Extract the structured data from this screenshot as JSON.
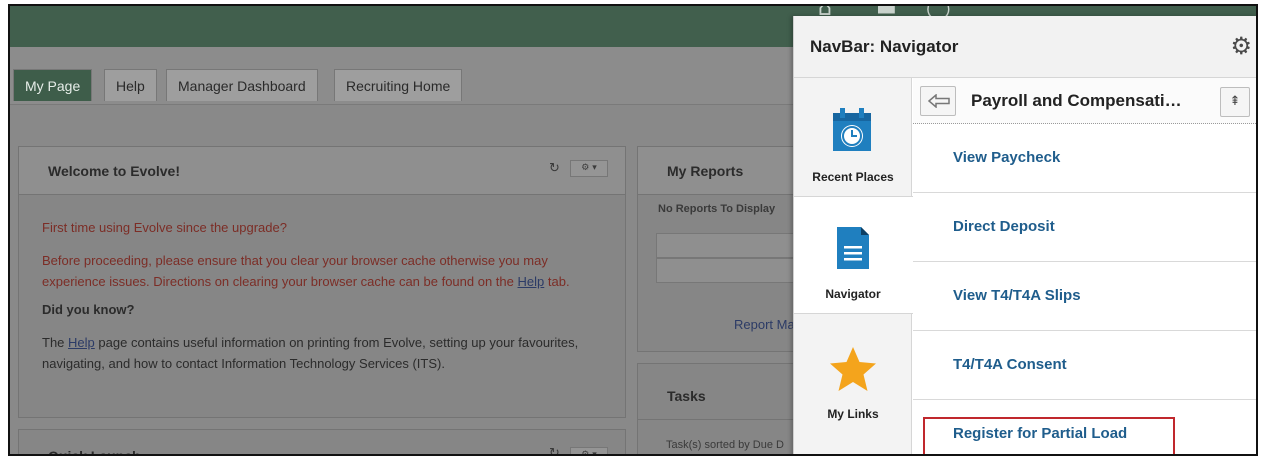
{
  "tabs": [
    {
      "label": "My Page"
    },
    {
      "label": "Help"
    },
    {
      "label": "Manager Dashboard"
    },
    {
      "label": "Recruiting Home"
    }
  ],
  "welcome": {
    "title": "Welcome to Evolve!",
    "headline": "First time using Evolve since the upgrade?",
    "warning_line1": "Before proceeding, please ensure that you clear your browser cache otherwise you may",
    "warning_line2_pre": "experience issues. Directions on clearing your browser cache can be found on the",
    "warning_link": "Help",
    "warning_line2_post": "tab.",
    "did_you_know": "Did you know?",
    "info_pre": "The",
    "info_link": "Help",
    "info_line1_post": "page contains useful information on printing from Evolve, setting up your favourites,",
    "info_line2": "navigating, and how to contact Information Technology Services (ITS)."
  },
  "quick_launch": {
    "title": "Quick Launch"
  },
  "reports": {
    "title": "My Reports",
    "empty": "No Reports To Display",
    "footer_link": "Report Ma"
  },
  "tasks": {
    "title": "Tasks",
    "sorted": "Task(s) sorted by Due D"
  },
  "navbar": {
    "title": "NavBar: Navigator",
    "rail": [
      {
        "label": "Recent Places"
      },
      {
        "label": "Navigator"
      },
      {
        "label": "My Links"
      }
    ],
    "breadcrumb": "Payroll and Compensati…",
    "items": [
      {
        "label": "View Paycheck"
      },
      {
        "label": "Direct Deposit"
      },
      {
        "label": "View T4/T4A Slips"
      },
      {
        "label": "T4/T4A Consent"
      },
      {
        "label": "Register for Partial Load"
      }
    ]
  },
  "colors": {
    "banner": "#415f4d",
    "link": "#1f5d8c",
    "highlight": "#c0282d",
    "calendar": "#1f7fbf",
    "star": "#f4a41c"
  }
}
